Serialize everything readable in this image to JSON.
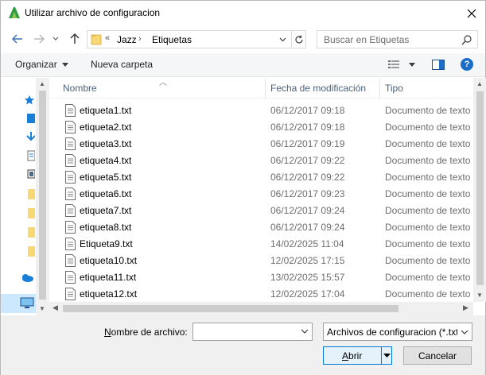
{
  "window": {
    "title": "Utilizar archivo de configuracion",
    "accent": "#0078d7"
  },
  "address": {
    "overflow": "«",
    "path": [
      "Jazz",
      "Etiquetas"
    ]
  },
  "search": {
    "placeholder": "Buscar en Etiquetas"
  },
  "toolbar": {
    "organize": "Organizar",
    "new_folder": "Nueva carpeta"
  },
  "columns": {
    "name": "Nombre",
    "date": "Fecha de modificación",
    "type": "Tipo"
  },
  "files": [
    {
      "name": "etiqueta1.txt",
      "date": "06/12/2017 09:18",
      "type": "Documento de texto"
    },
    {
      "name": "etiqueta2.txt",
      "date": "06/12/2017 09:18",
      "type": "Documento de texto"
    },
    {
      "name": "etiqueta3.txt",
      "date": "06/12/2017 09:19",
      "type": "Documento de texto"
    },
    {
      "name": "etiqueta4.txt",
      "date": "06/12/2017 09:22",
      "type": "Documento de texto"
    },
    {
      "name": "etiqueta5.txt",
      "date": "06/12/2017 09:22",
      "type": "Documento de texto"
    },
    {
      "name": "etiqueta6.txt",
      "date": "06/12/2017 09:23",
      "type": "Documento de texto"
    },
    {
      "name": "etiqueta7.txt",
      "date": "06/12/2017 09:24",
      "type": "Documento de texto"
    },
    {
      "name": "etiqueta8.txt",
      "date": "06/12/2017 09:24",
      "type": "Documento de texto"
    },
    {
      "name": "Etiqueta9.txt",
      "date": "14/02/2025 11:04",
      "type": "Documento de texto"
    },
    {
      "name": "etiqueta10.txt",
      "date": "12/02/2025 17:15",
      "type": "Documento de texto"
    },
    {
      "name": "etiqueta11.txt",
      "date": "13/02/2025 15:57",
      "type": "Documento de texto"
    },
    {
      "name": "etiqueta12.txt",
      "date": "12/02/2025 17:04",
      "type": "Documento de texto"
    }
  ],
  "bottom": {
    "filename_label_underlined": "N",
    "filename_label_rest": "ombre de archivo:",
    "filename_value": "",
    "filetype_value": "Archivos de configuracion (*.txt)",
    "open_underlined": "A",
    "open_rest": "brir",
    "cancel": "Cancelar"
  }
}
